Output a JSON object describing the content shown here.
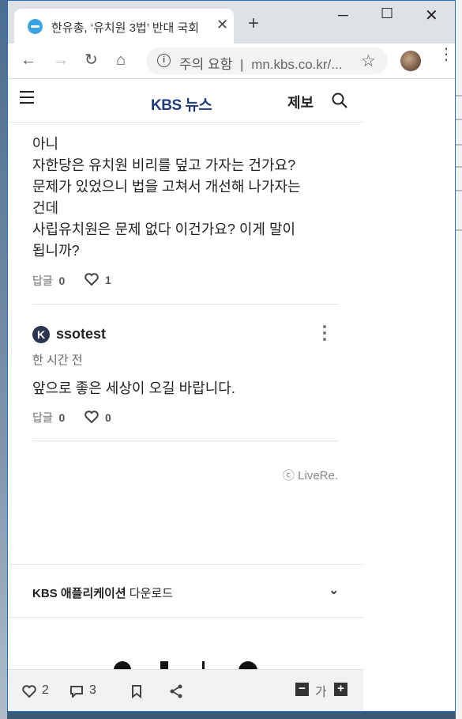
{
  "browser": {
    "tab_title": "한유총, ‘유치원 3법’ 반대 국회",
    "omnibox": {
      "warning": "주의 요함",
      "separator": "|",
      "url": "mn.kbs.co.kr/..."
    }
  },
  "site": {
    "logo_kbs": "KBS",
    "logo_news": "뉴스",
    "report_label": "제보"
  },
  "comments": [
    {
      "lines": [
        "아니",
        "자한당은 유치원 비리를 덮고 가자는 건가요?",
        "문제가 있었으니 법을 고쳐서 개선해 나가자는",
        "건데",
        "사립유치원은 문제 없다 이건가요? 이게 말이",
        "됩니까?"
      ],
      "reply_label": "답글",
      "reply_count": "0",
      "like_count": "1"
    },
    {
      "avatar_letter": "K",
      "author": "ssotest",
      "time": "한 시간 전",
      "lines": [
        "앞으로 좋은 세상이 오길 바랍니다."
      ],
      "reply_label": "답글",
      "reply_count": "0",
      "like_count": "0"
    }
  ],
  "livere": "ⓒ LiveRe.",
  "app_download": {
    "bold": "KBS 애플리케이션",
    "rest": " 다운로드"
  },
  "bottombar": {
    "likes": "2",
    "comments": "3",
    "font_label": "가"
  }
}
